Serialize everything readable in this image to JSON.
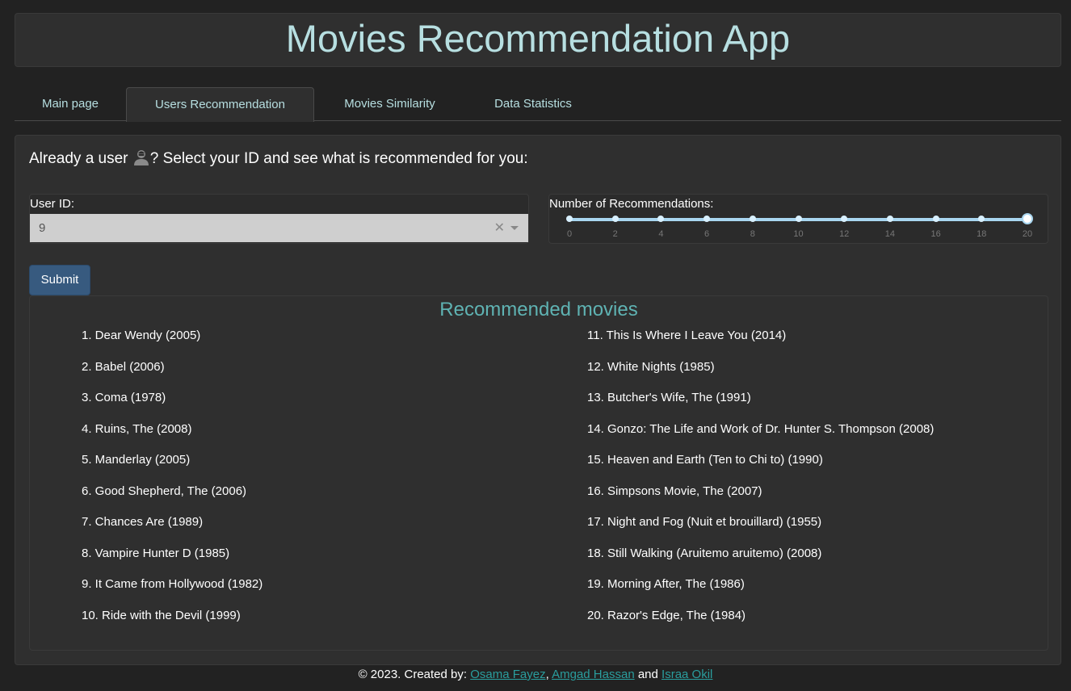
{
  "app": {
    "title": "Movies Recommendation App"
  },
  "tabs": [
    {
      "label": "Main page"
    },
    {
      "label": "Users Recommendation"
    },
    {
      "label": "Movies Similarity"
    },
    {
      "label": "Data Statistics"
    }
  ],
  "intro": {
    "before": "Already a user ",
    "icon": "person-icon",
    "after": "? Select your ID and see what is recommended for you:"
  },
  "user_select": {
    "label": "User ID:",
    "value": "9"
  },
  "slider": {
    "label": "Number of Recommendations:",
    "min": 0,
    "max": 20,
    "value": 20,
    "ticks": [
      "0",
      "2",
      "4",
      "6",
      "8",
      "10",
      "12",
      "14",
      "16",
      "18",
      "20"
    ]
  },
  "submit_label": "Submit",
  "results": {
    "heading": "Recommended movies",
    "left": [
      "1. Dear Wendy (2005)",
      "2. Babel (2006)",
      "3. Coma (1978)",
      "4. Ruins, The (2008)",
      "5. Manderlay (2005)",
      "6. Good Shepherd, The (2006)",
      "7. Chances Are (1989)",
      "8. Vampire Hunter D (1985)",
      "9. It Came from Hollywood (1982)",
      "10. Ride with the Devil (1999)"
    ],
    "right": [
      "11. This Is Where I Leave You (2014)",
      "12. White Nights (1985)",
      "13. Butcher's Wife, The (1991)",
      "14. Gonzo: The Life and Work of Dr. Hunter S. Thompson (2008)",
      "15. Heaven and Earth (Ten to Chi to) (1990)",
      "16. Simpsons Movie, The (2007)",
      "17. Night and Fog (Nuit et brouillard) (1955)",
      "18. Still Walking (Aruitemo aruitemo) (2008)",
      "19. Morning After, The (1986)",
      "20. Razor's Edge, The (1984)"
    ]
  },
  "footer": {
    "prefix": "© 2023. Created by: ",
    "author1": "Osama Fayez",
    "sep1": ", ",
    "author2": "Amgad Hassan",
    "sep2": " and ",
    "author3": "Israa Okil"
  },
  "colors": {
    "background": "#222222",
    "panel": "#2f2f2f",
    "title": "#b7dfe1",
    "heading": "#5fb3b3",
    "link": "#2a9d9d",
    "button": "#375a7f",
    "slider": "#a9d6f0"
  }
}
